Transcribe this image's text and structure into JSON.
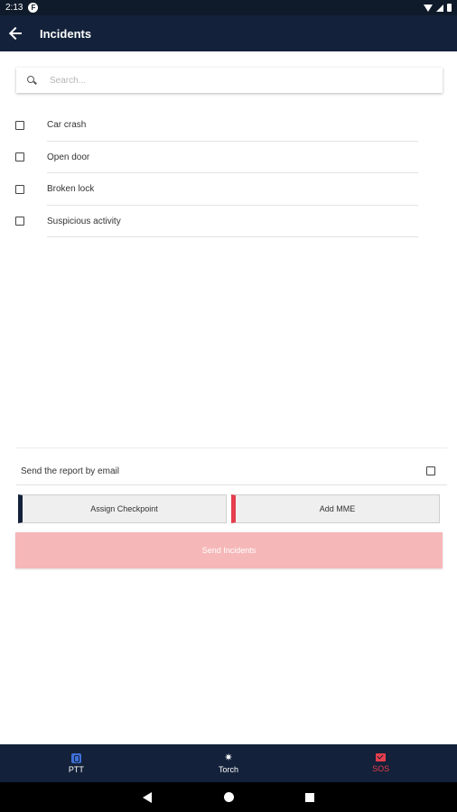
{
  "status_bar": {
    "time": "2:13",
    "app_icon_letter": "F"
  },
  "header": {
    "title": "Incidents"
  },
  "search": {
    "placeholder": "Search..."
  },
  "incidents": [
    {
      "label": "Car crash",
      "checked": false
    },
    {
      "label": "Open door",
      "checked": false
    },
    {
      "label": "Broken lock",
      "checked": false
    },
    {
      "label": "Suspicious activity",
      "checked": false
    }
  ],
  "email_option": {
    "label": "Send the report by email",
    "checked": false
  },
  "buttons": {
    "assign_checkpoint": "Assign Checkpoint",
    "add_mme": "Add MME",
    "send_incidents": "Send Incidents"
  },
  "bottom_nav": {
    "ptt": "PTT",
    "torch": "Torch",
    "sos": "SOS"
  },
  "colors": {
    "header_bg": "#13213a",
    "accent_red": "#e53e4c",
    "send_button_bg": "#f6b7b8",
    "ptt_icon": "#3f6fd8"
  },
  "icons": {
    "back": "arrow-left-icon",
    "search": "search-icon",
    "ptt": "walkie-talkie-icon",
    "torch": "flashlight-icon",
    "sos": "alert-envelope-icon"
  }
}
